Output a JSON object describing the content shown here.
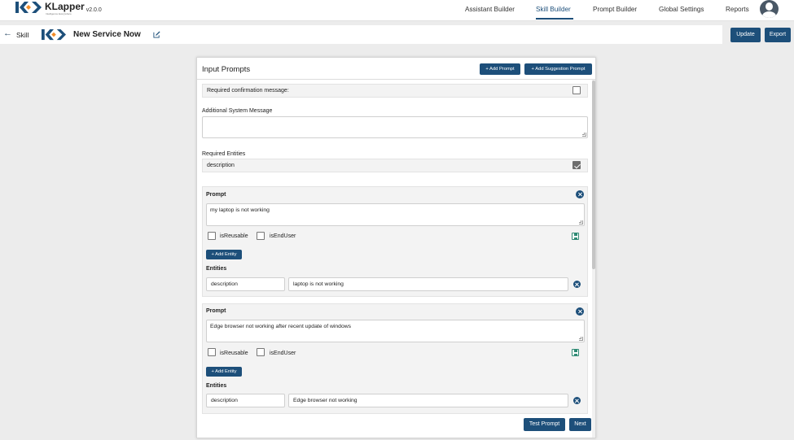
{
  "app": {
    "name": "KLapper",
    "tagline": "Intelligence Everywhere",
    "version": "v2.0.0"
  },
  "nav": {
    "items": [
      {
        "label": "Assistant Builder"
      },
      {
        "label": "Skill Builder"
      },
      {
        "label": "Prompt Builder"
      },
      {
        "label": "Global Settings"
      },
      {
        "label": "Reports"
      }
    ],
    "active": "Skill Builder"
  },
  "subheader": {
    "back_label": "Skill",
    "skill_name": "New Service Now",
    "update_label": "Update",
    "export_label": "Export"
  },
  "panel": {
    "title": "Input Prompts",
    "add_prompt_label": "+ Add Prompt",
    "add_suggestion_label": "+ Add Suggestion Prompt",
    "required_confirmation_label": "Required confirmation message:",
    "required_confirmation_checked": false,
    "additional_system_message_label": "Additional System Message",
    "additional_system_message_value": "",
    "required_entities_label": "Required Entities",
    "required_entities": [
      {
        "name": "description",
        "checked": true
      }
    ],
    "prompts": [
      {
        "label": "Prompt",
        "text": "my laptop is not working",
        "is_reusable_label": "isReusable",
        "is_reusable": false,
        "is_end_user_label": "isEndUser",
        "is_end_user": false,
        "add_entity_label": "+ Add Entity",
        "entities_label": "Entities",
        "entities": [
          {
            "name": "description",
            "value": "laptop is not working"
          }
        ]
      },
      {
        "label": "Prompt",
        "text": "Edge browser not working after recent update of windows",
        "is_reusable_label": "isReusable",
        "is_reusable": false,
        "is_end_user_label": "isEndUser",
        "is_end_user": false,
        "add_entity_label": "+ Add Entity",
        "entities_label": "Entities",
        "entities": [
          {
            "name": "description",
            "value": "Edge browser not working"
          }
        ]
      }
    ],
    "test_prompt_label": "Test Prompt",
    "next_label": "Next"
  },
  "colors": {
    "primary": "#1d4f7a",
    "save_icon": "#2f8a74",
    "logo_blue": "#1d4f7a",
    "logo_orange": "#f28c28"
  },
  "icons": [
    "klapper-logo-icon",
    "back-arrow-icon",
    "edit-icon",
    "close-icon",
    "save-icon",
    "checkbox-icon",
    "avatar-icon"
  ]
}
